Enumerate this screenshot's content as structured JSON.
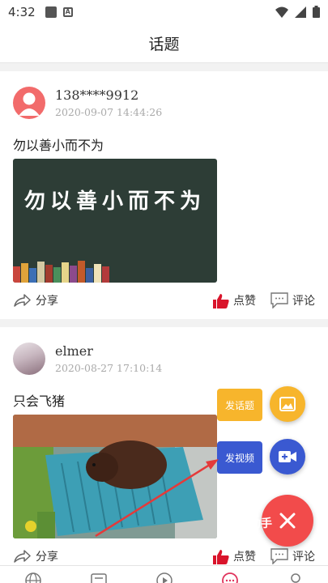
{
  "status_bar": {
    "time": "4:32"
  },
  "header": {
    "title": "话题"
  },
  "posts": [
    {
      "username": "138****9912",
      "time": "2020-09-07  14:44:26",
      "text": "勿以善小而不为",
      "image_text": "勿以善小而不为",
      "share": "分享",
      "like": "点赞",
      "comment": "评论"
    },
    {
      "username": "elmer",
      "time": "2020-08-27  17:10:14",
      "text": "只会飞猪",
      "share": "分享",
      "like": "点赞",
      "comment": "评论"
    }
  ],
  "fab": {
    "post_topic": "发话题",
    "post_video": "发视频",
    "helper": "助手",
    "colors": {
      "yellow": "#f7b52c",
      "blue": "#3a59d1",
      "red": "#f24b4b"
    }
  }
}
